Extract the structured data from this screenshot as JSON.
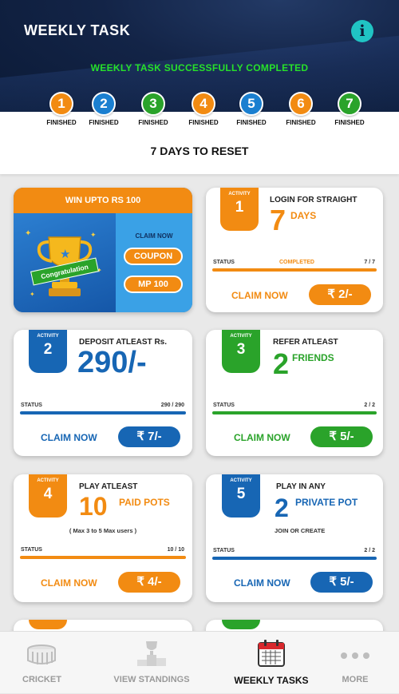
{
  "header": {
    "title": "WEEKLY TASK",
    "info_icon": "info-icon",
    "success_message": "WEEKLY TASK SUCCESSFULLY COMPLETED"
  },
  "days": [
    {
      "number": "1",
      "label": "FINISHED",
      "color": "#f28b12"
    },
    {
      "number": "2",
      "label": "FINISHED",
      "color": "#1a7fd0"
    },
    {
      "number": "3",
      "label": "FINISHED",
      "color": "#2aa32a"
    },
    {
      "number": "4",
      "label": "FINISHED",
      "color": "#f28b12"
    },
    {
      "number": "5",
      "label": "FINISHED",
      "color": "#1a7fd0"
    },
    {
      "number": "6",
      "label": "FINISHED",
      "color": "#f28b12"
    },
    {
      "number": "7",
      "label": "FINISHED",
      "color": "#2aa32a"
    }
  ],
  "reset_text": "7 DAYS TO RESET",
  "promo": {
    "title": "WIN UPTO RS 100",
    "ribbon_text": "Congratulation",
    "claim_now": "CLAIM NOW",
    "coupon_button": "COUPON",
    "mp_button": "MP 100"
  },
  "activities": [
    {
      "badge_label": "ACTIVITY",
      "number": "1",
      "title": "LOGIN FOR STRAIGHT",
      "big_value": "7",
      "unit": "DAYS",
      "status_label": "STATUS",
      "status_text": "COMPLETED",
      "status_count": "7 / 7",
      "progress": 1.0,
      "claim_label": "CLAIM NOW",
      "reward": "₹ 2/-",
      "color": "#f28b12"
    },
    {
      "badge_label": "ACTIVITY",
      "number": "2",
      "title": "DEPOSIT ATLEAST Rs.",
      "big_value": "290/-",
      "status_label": "STATUS",
      "status_count": "290 / 290",
      "progress": 1.0,
      "claim_label": "CLAIM NOW",
      "reward": "₹ 7/-",
      "color": "#1766b4"
    },
    {
      "badge_label": "ACTIVITY",
      "number": "3",
      "title": "REFER ATLEAST",
      "big_value": "2",
      "unit": "FRIENDS",
      "status_label": "STATUS",
      "status_count": "2 / 2",
      "progress": 1.0,
      "claim_label": "CLAIM NOW",
      "reward": "₹ 5/-",
      "color": "#2aa32a"
    },
    {
      "badge_label": "ACTIVITY",
      "number": "4",
      "title": "PLAY ATLEAST",
      "big_value": "10",
      "unit": "PAID POTS",
      "note": "( Max 3 to 5 Max users )",
      "status_label": "STATUS",
      "status_count": "10 / 10",
      "progress": 1.0,
      "claim_label": "CLAIM NOW",
      "reward": "₹ 4/-",
      "color": "#f28b12"
    },
    {
      "badge_label": "ACTIVITY",
      "number": "5",
      "title": "PLAY IN ANY",
      "big_value": "2",
      "unit": "PRIVATE POT",
      "note": "JOIN OR CREATE",
      "status_label": "STATUS",
      "status_count": "2 / 2",
      "progress": 1.0,
      "claim_label": "CLAIM NOW",
      "reward": "₹ 5/-",
      "color": "#1766b4"
    }
  ],
  "bottom_nav": [
    {
      "label": "CRICKET",
      "icon": "stadium-icon",
      "active": false
    },
    {
      "label": "VIEW STANDINGS",
      "icon": "podium-icon",
      "active": false
    },
    {
      "label": "WEEKLY TASKS",
      "icon": "calendar-icon",
      "active": true
    },
    {
      "label": "MORE",
      "icon": "more-dots-icon",
      "active": false
    }
  ]
}
